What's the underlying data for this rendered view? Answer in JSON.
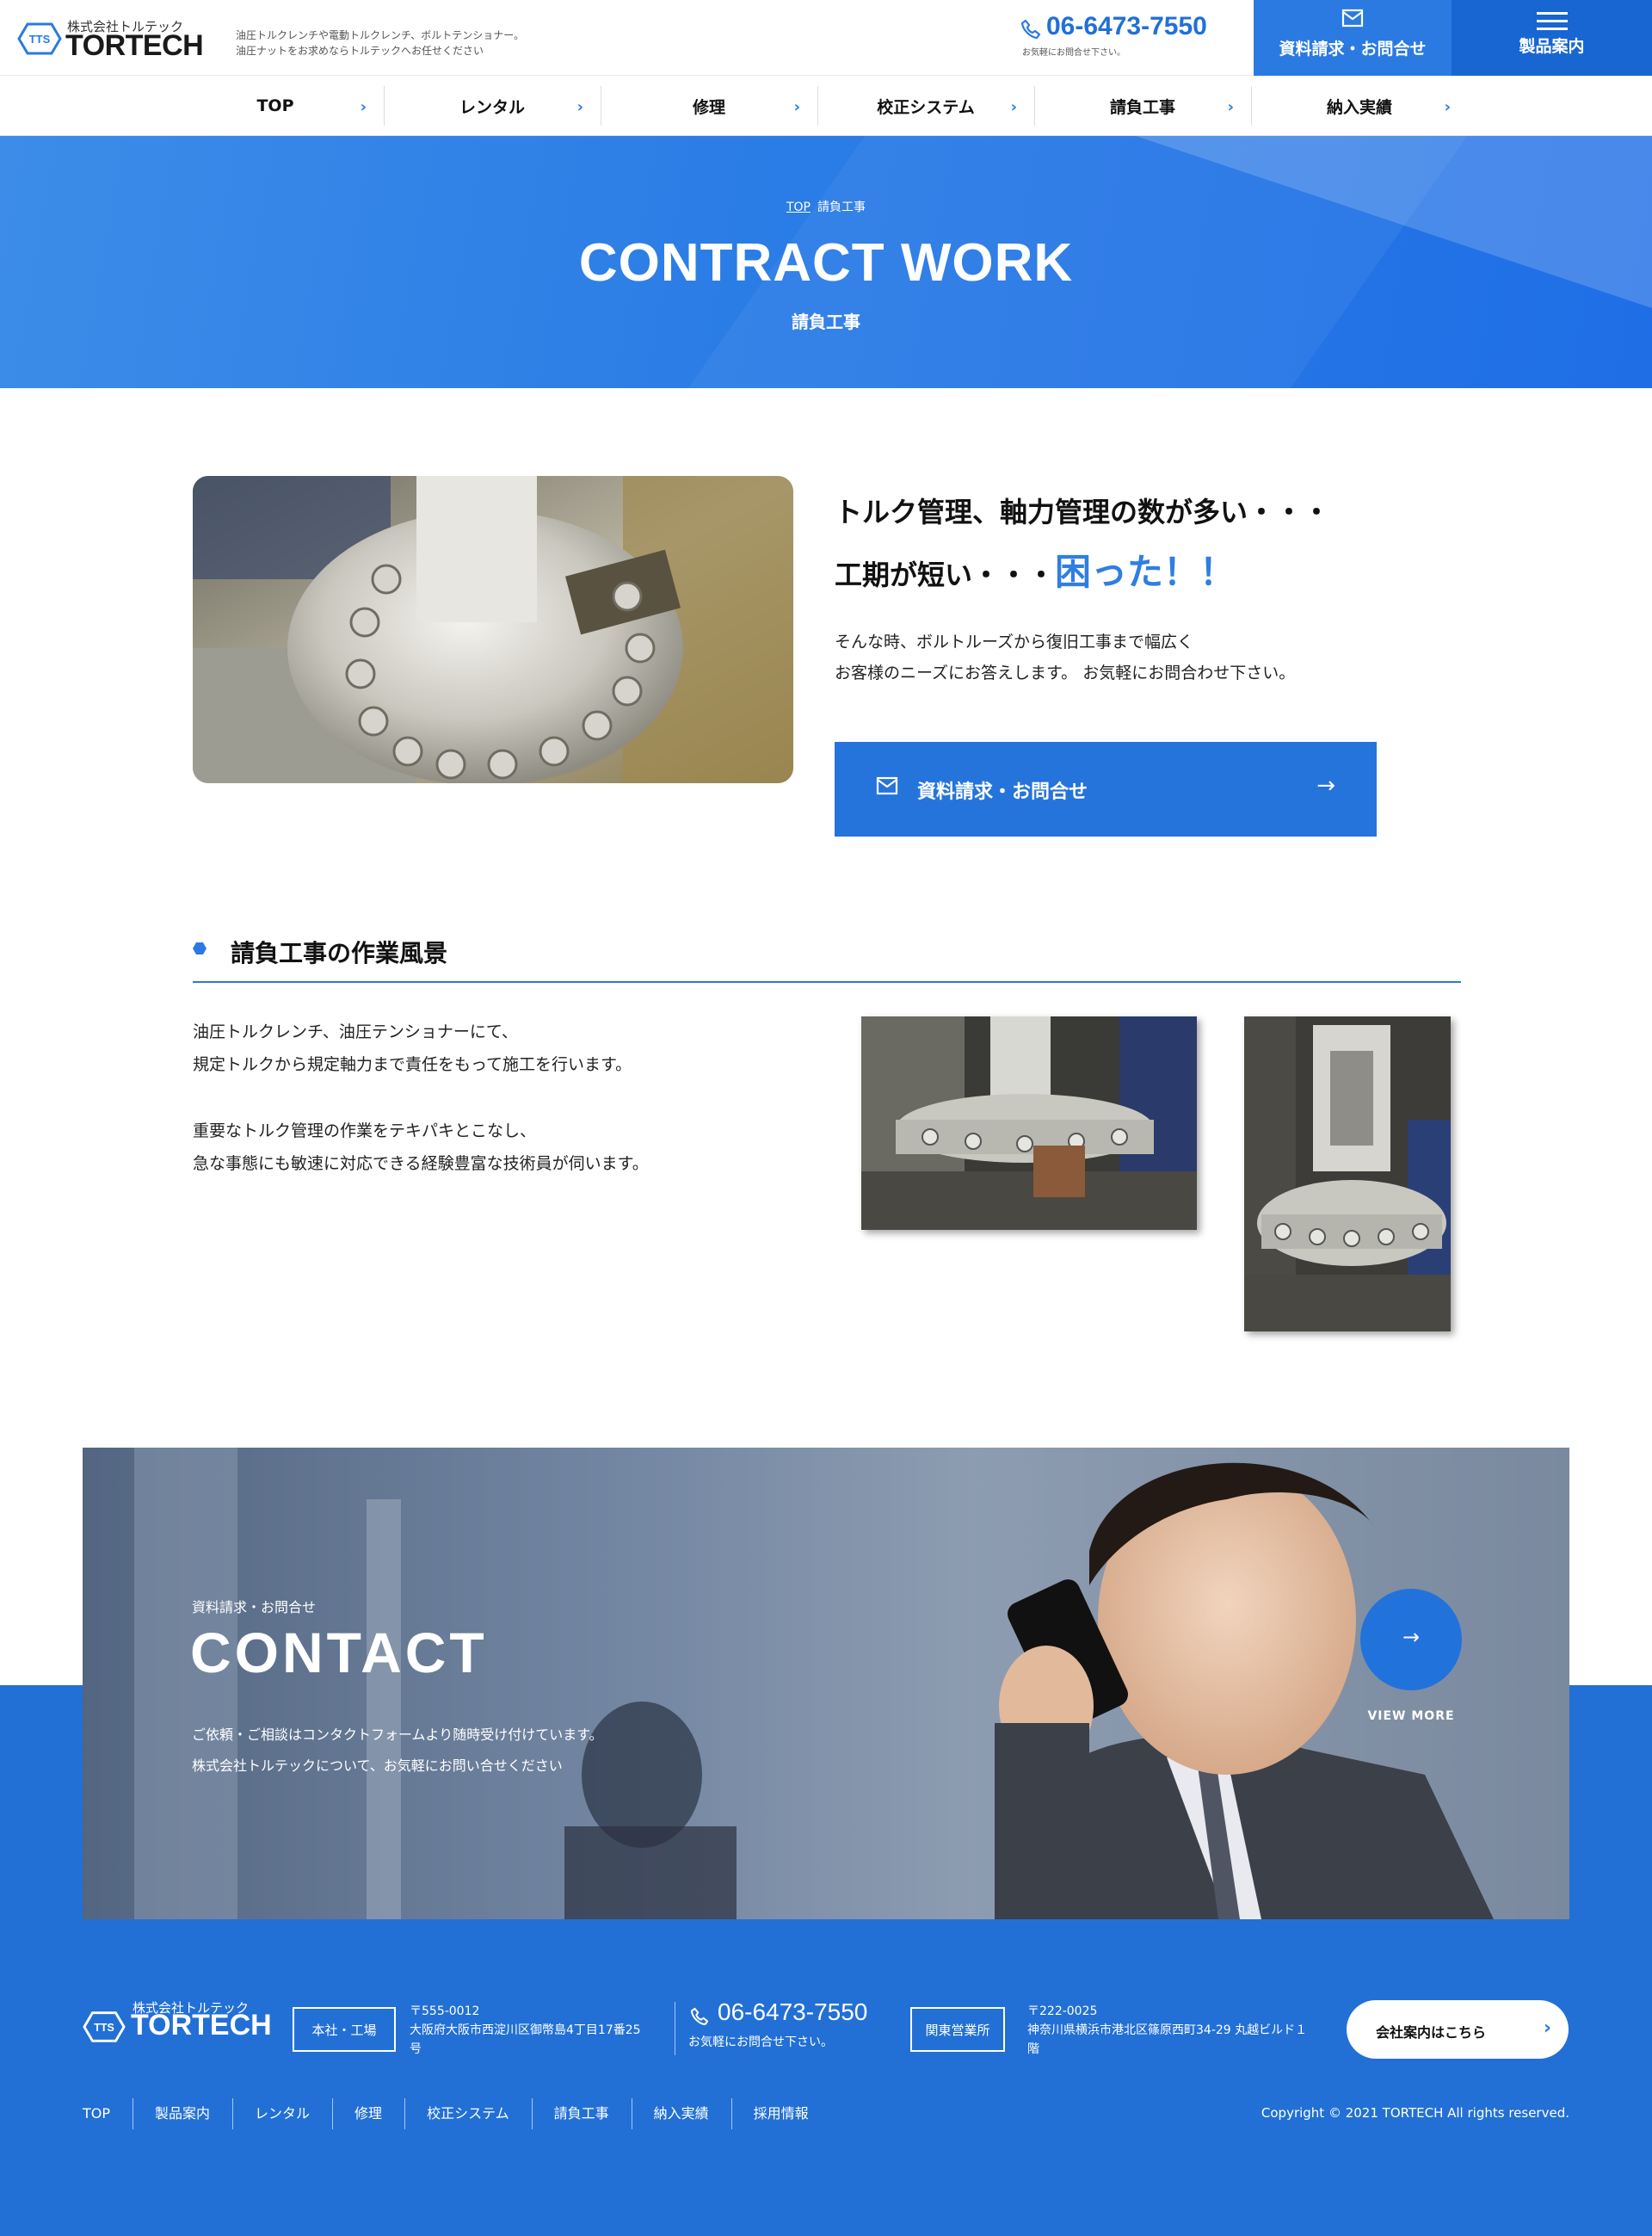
{
  "header": {
    "logo_small": "株式会社トルテック",
    "logo_big": "TORTECH",
    "logo_mark": "TTS",
    "tagline_line1": "油圧トルクレンチや電動トルクレンチ、ボルトテンショナー。",
    "tagline_line2": "油圧ナットをお求めならトルテックへお任せください",
    "phone": "06-6473-7550",
    "phone_sub": "お気軽にお問合せ下さい。",
    "contact_button": "資料請求・お問合せ",
    "products_button": "製品案内"
  },
  "nav": {
    "items": [
      {
        "label": "TOP"
      },
      {
        "label": "レンタル"
      },
      {
        "label": "修理"
      },
      {
        "label": "校正システム"
      },
      {
        "label": "請負工事"
      },
      {
        "label": "納入実績"
      }
    ]
  },
  "hero": {
    "breadcrumb_top": "TOP",
    "breadcrumb_current": "請負工事",
    "title": "CONTRACT WORK",
    "subtitle": "請負工事"
  },
  "intro": {
    "heading_line1": "トルク管理、軸力管理の数が多い・・・",
    "heading_line2_prefix": "工期が短い・・・",
    "heading_line2_accent": "困った！！",
    "paragraph_line1": "そんな時、ボルトルーズから復旧工事まで幅広く",
    "paragraph_line2": "お客様のニーズにお答えします。 お気軽にお問合わせ下さい。",
    "button_label": "資料請求・お問合せ"
  },
  "scenery": {
    "title": "請負工事の作業風景",
    "p1_line1": "油圧トルクレンチ、油圧テンショナーにて、",
    "p1_line2": "規定トルクから規定軸力まで責任をもって施工を行います。",
    "p2_line1": "重要なトルク管理の作業をテキパキとこなし、",
    "p2_line2": "急な事態にも敏速に対応できる経験豊富な技術員が伺います。"
  },
  "contact": {
    "label": "資料請求・お問合せ",
    "title": "CONTACT",
    "p_line1": "ご依頼・ご相談はコンタクトフォームより随時受け付けています。",
    "p_line2": "株式会社トルテックについて、お気軽にお問い合せください",
    "view_more": "VIEW MORE"
  },
  "footer": {
    "logo_small": "株式会社トルテック",
    "logo_big": "TORTECH",
    "logo_mark": "TTS",
    "hq_tag": "本社・工場",
    "hq_zip": "〒555-0012",
    "hq_addr_line1": "大阪府大阪市西淀川区御幣島4丁目17番25",
    "hq_addr_line2": "号",
    "phone": "06-6473-7550",
    "phone_sub": "お気軽にお問合せ下さい。",
    "kanto_tag": "関東営業所",
    "kanto_zip": "〒222-0025",
    "kanto_addr_line1": "神奈川県横浜市港北区篠原西町34-29 丸越ビルド１",
    "kanto_addr_line2": "階",
    "company_button": "会社案内はこちら",
    "nav": [
      "TOP",
      "製品案内",
      "レンタル",
      "修理",
      "校正システム",
      "請負工事",
      "納入実績",
      "採用情報"
    ],
    "copyright": "Copyright © 2021 TORTECH All rights reserved."
  },
  "colors": {
    "accent": "#2a7ae2",
    "footer_bg": "#2270d6",
    "hero_bg": "#2b7de6"
  }
}
